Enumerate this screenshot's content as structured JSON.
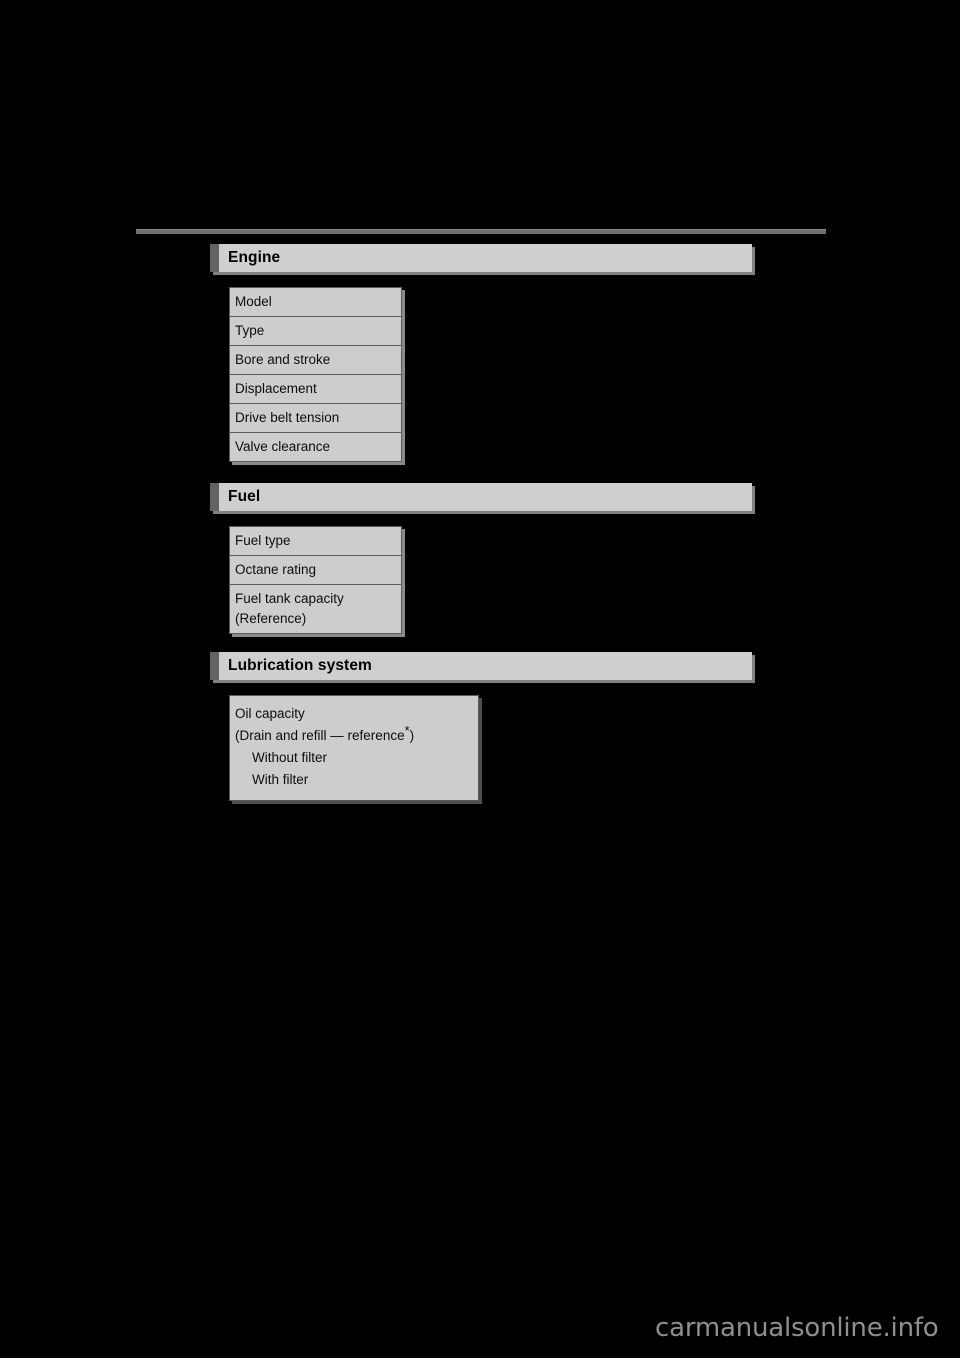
{
  "page": {
    "background_color": "#000000",
    "watermark": "carmanualsonline.info"
  },
  "sections": [
    {
      "id": "engine",
      "title": "Engine",
      "rows": [
        {
          "label": "Model"
        },
        {
          "label": "Type"
        },
        {
          "label": "Bore and stroke"
        },
        {
          "label": "Displacement"
        },
        {
          "label": "Drive belt tension"
        },
        {
          "label": "Valve clearance"
        }
      ]
    },
    {
      "id": "fuel",
      "title": "Fuel",
      "rows": [
        {
          "label": "Fuel type"
        },
        {
          "label": "Octane rating"
        },
        {
          "label": "Fuel tank capacity",
          "label2": "(Reference)"
        }
      ]
    },
    {
      "id": "lubrication-system",
      "title": "Lubrication system",
      "oil_block": {
        "line1": "Oil capacity",
        "line2_pre": "(Drain and refill ",
        "line2_dash": "—",
        "line2_mid": " reference",
        "line2_sup": "*",
        "line2_post": ")",
        "line3": "Without filter",
        "line4": "With filter"
      }
    }
  ],
  "colors": {
    "section_header_bg": "#cfcfcf",
    "section_accent": "#636363",
    "cell_bg": "#cdcdcd",
    "cell_border": "#5a5a5a",
    "shadow": "#808080",
    "rule": "#6e6e6e",
    "text": "#0d0d0d",
    "watermark": "#8f8f8f"
  }
}
